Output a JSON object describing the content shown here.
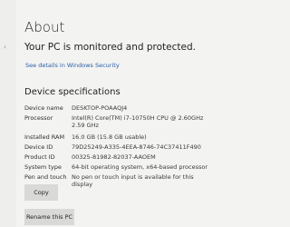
{
  "page_title": "About",
  "status_message": "Your PC is monitored and protected.",
  "security_link": "See details in Windows Security",
  "device_specs": {
    "heading": "Device specifications",
    "rows": [
      {
        "label": "Device name",
        "value": "DESKTOP-POAAQJ4"
      },
      {
        "label": "Processor",
        "value": "Intel(R) Core(TM) i7-10750H CPU @ 2.60GHz   2.59 GHz"
      },
      {
        "label": "Installed RAM",
        "value": "16.0 GB (15.8 GB usable)"
      },
      {
        "label": "Device ID",
        "value": "79D25249-A335-4EEA-8746-74C37411F490"
      },
      {
        "label": "Product ID",
        "value": "00325-81982-82037-AAOEM"
      },
      {
        "label": "System type",
        "value": "64-bit operating system, x64-based processor"
      },
      {
        "label": "Pen and touch",
        "value": "No pen or touch input is available for this display"
      }
    ]
  },
  "buttons": {
    "copy": "Copy",
    "rename": "Rename this PC"
  },
  "icons": {
    "nav": "back-arrow-icon"
  },
  "colors": {
    "background": "#f3f3f1",
    "link": "#2a5fa8",
    "button": "#d9d9d7"
  }
}
